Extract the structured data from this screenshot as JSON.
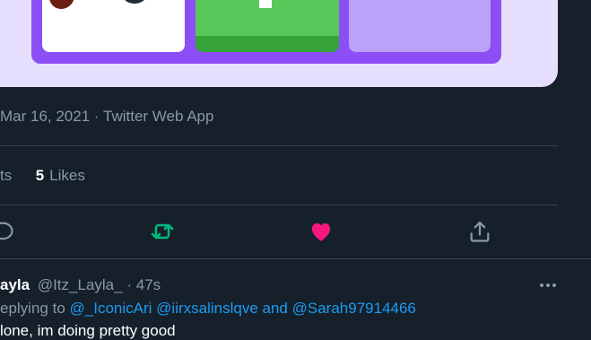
{
  "tweet": {
    "date": "Mar 16, 2021",
    "client": "Twitter Web App",
    "separator": " · ",
    "stats": {
      "retweets_label_fragment": "ts",
      "likes_count": "5",
      "likes_label": "Likes"
    },
    "actions": [
      "reply-icon",
      "retweet-icon",
      "like-icon",
      "share-icon"
    ],
    "colors": {
      "retweet_active": "#00ba7c",
      "like_active": "#f91880",
      "mention": "#1d9bf0"
    }
  },
  "reply": {
    "display_name": "ayla",
    "handle": "@Itz_Layla_",
    "separator": "·",
    "time": "47s",
    "replying_prefix": "eplying to",
    "mentions": [
      "@_IconicAri",
      "@iirxsalinslqve"
    ],
    "and_text": "and",
    "last_mention": "@Sarah97914466",
    "text": "lone, im doing pretty good"
  }
}
